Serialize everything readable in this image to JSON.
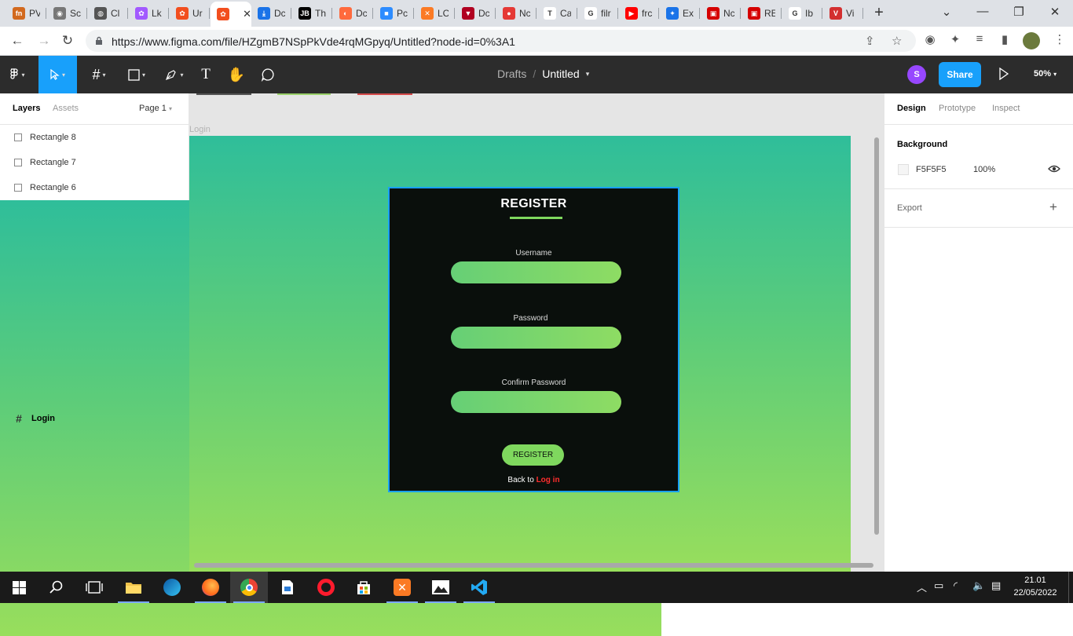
{
  "browser": {
    "tabs": [
      {
        "icon": "fn-icon",
        "title": "PV",
        "color": "#d2691e",
        "glyph": "fn"
      },
      {
        "icon": "camera-icon",
        "title": "Sc",
        "color": "#777777",
        "glyph": "◉"
      },
      {
        "icon": "globe-icon",
        "title": "Cl",
        "color": "#555555",
        "glyph": "◍"
      },
      {
        "icon": "figma-icon",
        "title": "Lk",
        "color": "#a259ff",
        "glyph": "✿"
      },
      {
        "icon": "figma-icon",
        "title": "Ur",
        "color": "#f24e1e",
        "glyph": "✿"
      },
      {
        "icon": "figma-icon",
        "title": "",
        "color": "#f24e1e",
        "glyph": "✿",
        "active": true
      },
      {
        "icon": "download-icon",
        "title": "Dc",
        "color": "#1a73e8",
        "glyph": "⤓"
      },
      {
        "icon": "jb-icon",
        "title": "Th",
        "color": "#000000",
        "glyph": "JB"
      },
      {
        "icon": "dc-icon",
        "title": "Dc",
        "color": "#ff6a3d",
        "glyph": "◐"
      },
      {
        "icon": "zoom-icon",
        "title": "Pc",
        "color": "#2d8cff",
        "glyph": "■"
      },
      {
        "icon": "xampp-icon",
        "title": "LC",
        "color": "#fb7a24",
        "glyph": "✕"
      },
      {
        "icon": "shield-icon",
        "title": "Dc",
        "color": "#b00020",
        "glyph": "▼"
      },
      {
        "icon": "record-icon",
        "title": "Nc",
        "color": "#e53935",
        "glyph": "●"
      },
      {
        "icon": "t-icon",
        "title": "Ca",
        "color": "#ffffff",
        "glyph": "T"
      },
      {
        "icon": "google-icon",
        "title": "filr",
        "color": "#ffffff",
        "glyph": "G"
      },
      {
        "icon": "youtube-icon",
        "title": "frc",
        "color": "#ff0000",
        "glyph": "▶"
      },
      {
        "icon": "puzzle-icon",
        "title": "Ex",
        "color": "#1a73e8",
        "glyph": "✦"
      },
      {
        "icon": "video-icon",
        "title": "Nc",
        "color": "#d50000",
        "glyph": "▣"
      },
      {
        "icon": "video-icon",
        "title": "RE",
        "color": "#d50000",
        "glyph": "▣"
      },
      {
        "icon": "google-icon",
        "title": "Ib",
        "color": "#ffffff",
        "glyph": "G"
      },
      {
        "icon": "vivaldi-icon",
        "title": "Vi",
        "color": "#d32f2f",
        "glyph": "V"
      }
    ],
    "new_tab": "+",
    "url": "https://www.figma.com/file/HZgmB7NSpPkVde4rqMGpyq/Untitled?node-id=0%3A1"
  },
  "figma": {
    "breadcrumb": {
      "folder": "Drafts",
      "separator": "/",
      "file": "Untitled"
    },
    "avatar_initial": "S",
    "share_label": "Share",
    "zoom_label": "50%",
    "left_panel": {
      "tabs": {
        "layers": "Layers",
        "assets": "Assets"
      },
      "page": "Page 1",
      "layers": [
        {
          "name": "Rectangle 8",
          "type": "rectangle"
        },
        {
          "name": "Rectangle 7",
          "type": "rectangle"
        },
        {
          "name": "Rectangle 6",
          "type": "rectangle"
        },
        {
          "name": "Login",
          "type": "frame"
        }
      ]
    },
    "canvas": {
      "frame_label": "Login",
      "card": {
        "title": "REGISTER",
        "fields": [
          "Username",
          "Password",
          "Confirm Password"
        ],
        "button": "REGISTER",
        "back_text": "Back to",
        "back_link": "Log in"
      },
      "help": "?"
    },
    "right_panel": {
      "tabs": {
        "design": "Design",
        "prototype": "Prototype",
        "inspect": "Inspect"
      },
      "background_title": "Background",
      "background_hex": "F5F5F5",
      "background_opacity": "100%",
      "export_label": "Export",
      "export_add": "+"
    }
  },
  "taskbar": {
    "time": "21.01",
    "date": "22/05/2022"
  }
}
